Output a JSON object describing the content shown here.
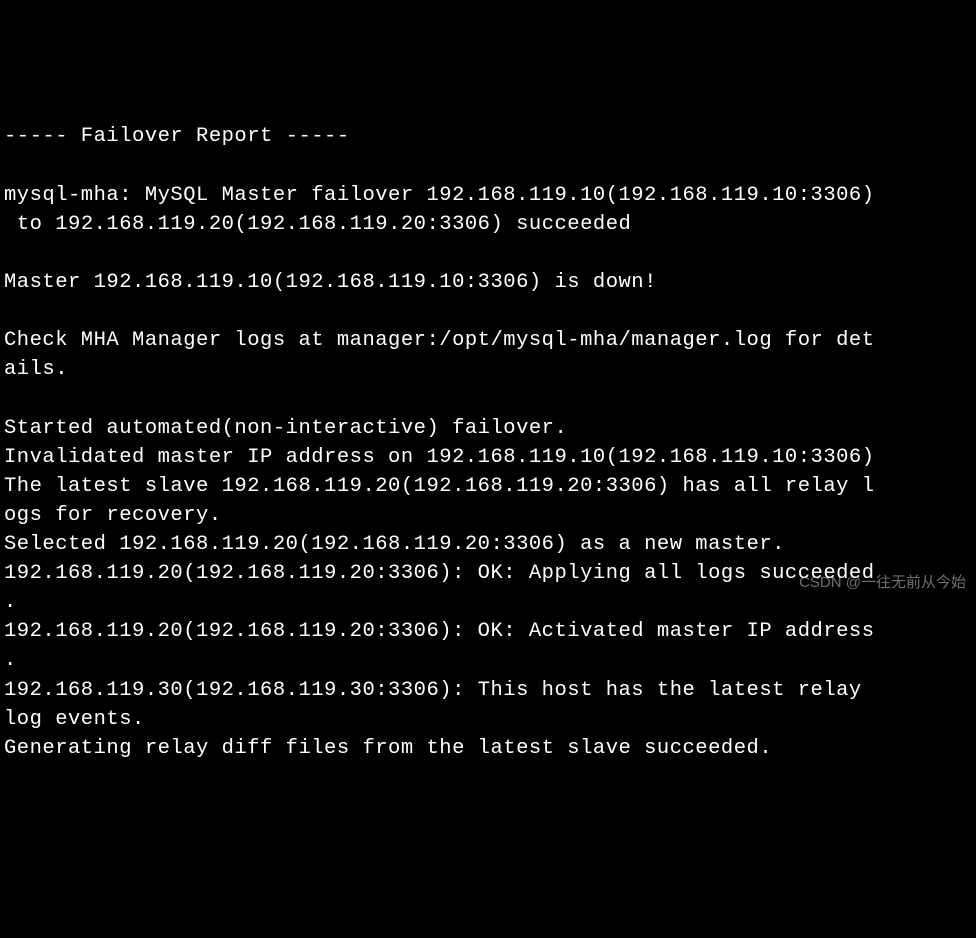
{
  "terminal": {
    "lines": [
      "----- Failover Report -----",
      "",
      "mysql-mha: MySQL Master failover 192.168.119.10(192.168.119.10:3306)",
      " to 192.168.119.20(192.168.119.20:3306) succeeded",
      "",
      "Master 192.168.119.10(192.168.119.10:3306) is down!",
      "",
      "Check MHA Manager logs at manager:/opt/mysql-mha/manager.log for det",
      "ails.",
      "",
      "Started automated(non-interactive) failover.",
      "Invalidated master IP address on 192.168.119.10(192.168.119.10:3306)",
      "The latest slave 192.168.119.20(192.168.119.20:3306) has all relay l",
      "ogs for recovery.",
      "Selected 192.168.119.20(192.168.119.20:3306) as a new master.",
      "192.168.119.20(192.168.119.20:3306): OK: Applying all logs succeeded",
      ".",
      "192.168.119.20(192.168.119.20:3306): OK: Activated master IP address",
      ".",
      "192.168.119.30(192.168.119.30:3306): This host has the latest relay ",
      "log events.",
      "Generating relay diff files from the latest slave succeeded."
    ]
  },
  "watermark": {
    "text": "CSDN @一往无前从今始"
  }
}
